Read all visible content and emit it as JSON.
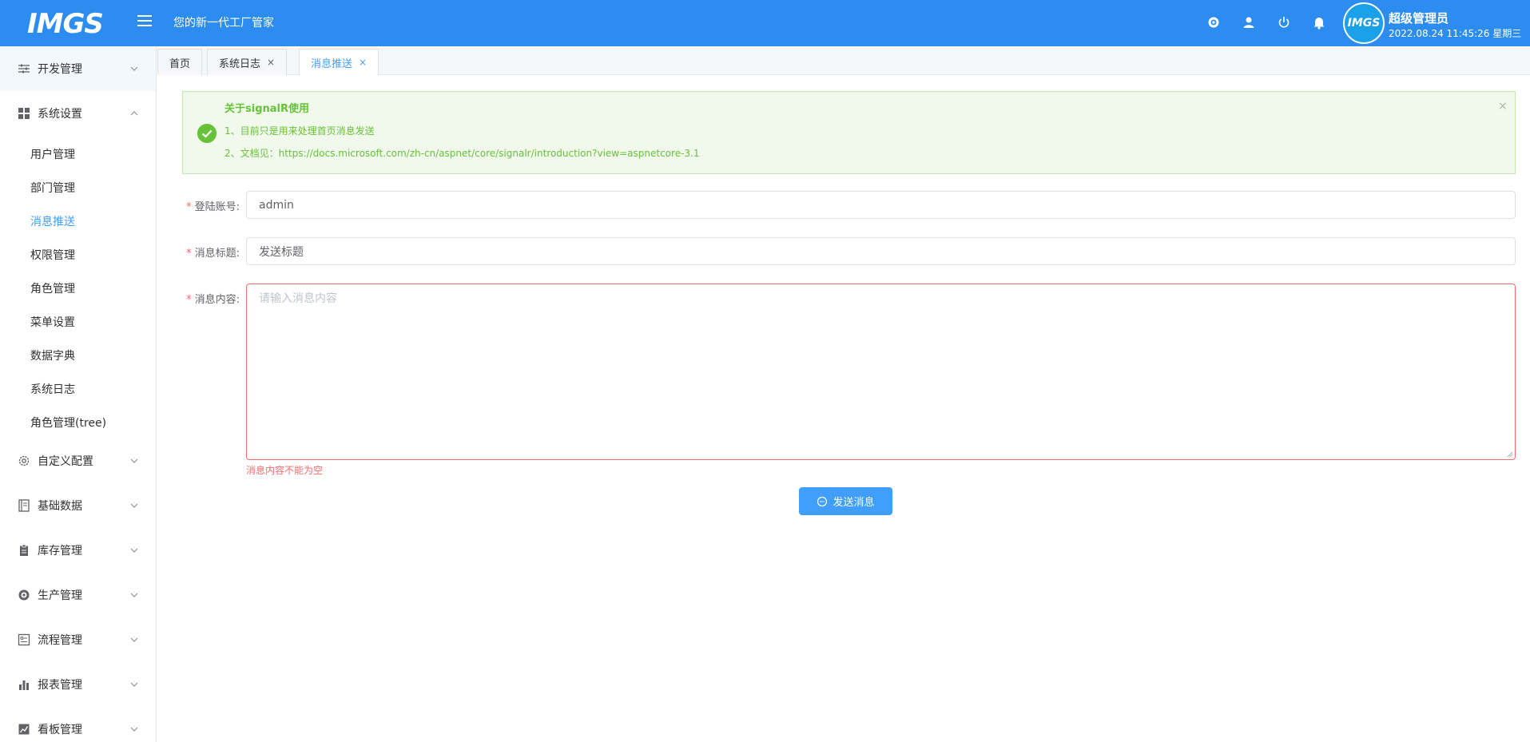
{
  "header": {
    "logo": "IMGS",
    "slogan": "您的新一代工厂管家",
    "user_name": "超级管理员",
    "datetime": "2022.08.24 11:45:26 星期三",
    "avatar_text": "IMGS",
    "icons": [
      "gear-icon",
      "user-icon",
      "power-icon",
      "bell-icon"
    ]
  },
  "sidebar": {
    "menus": [
      {
        "label": "开发管理",
        "icon": "sliders-icon"
      },
      {
        "label": "系统设置",
        "icon": "grid-icon",
        "expanded": true
      },
      {
        "label": "自定义配置",
        "icon": "gear-outline-icon"
      },
      {
        "label": "基础数据",
        "icon": "ledger-icon"
      },
      {
        "label": "库存管理",
        "icon": "clipboard-icon"
      },
      {
        "label": "生产管理",
        "icon": "cog-icon"
      },
      {
        "label": "流程管理",
        "icon": "flow-icon"
      },
      {
        "label": "报表管理",
        "icon": "bar-chart-icon"
      },
      {
        "label": "看板管理",
        "icon": "trend-icon"
      }
    ],
    "submenu": [
      {
        "label": "用户管理"
      },
      {
        "label": "部门管理"
      },
      {
        "label": "消息推送",
        "active": true
      },
      {
        "label": "权限管理"
      },
      {
        "label": "角色管理"
      },
      {
        "label": "菜单设置"
      },
      {
        "label": "数据字典"
      },
      {
        "label": "系统日志"
      },
      {
        "label": "角色管理(tree)"
      }
    ]
  },
  "tabs": [
    {
      "label": "首页"
    },
    {
      "label": "系统日志",
      "close": "×"
    },
    {
      "label": "消息推送",
      "close": "×",
      "active": true
    }
  ],
  "alert": {
    "title": "关于signalR使用",
    "line1": "1、目前只是用来处理首页消息发送",
    "line2": "2、文档见：https://docs.microsoft.com/zh-cn/aspnet/core/signalr/introduction?view=aspnetcore-3.1",
    "close": "×"
  },
  "form": {
    "required_mark": "*",
    "account_label": "登陆账号:",
    "account_value": "admin",
    "title_label": "消息标题:",
    "title_value": "发送标题",
    "content_label": "消息内容:",
    "content_placeholder": "请输入消息内容",
    "content_error": "消息内容不能为空",
    "send_label": "发送消息"
  },
  "colors": {
    "header_bg": "#2d8cf0",
    "primary": "#409eff",
    "success": "#67c23a",
    "danger": "#f56c6c"
  }
}
